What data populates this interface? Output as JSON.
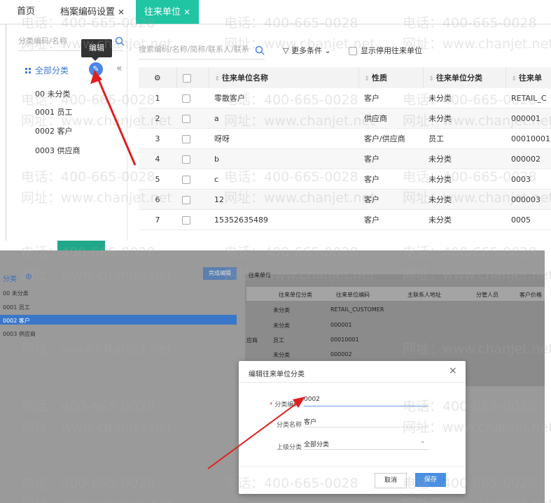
{
  "tabs": [
    {
      "label": "首页",
      "closable": false
    },
    {
      "label": "档案编码设置",
      "closable": true
    },
    {
      "label": "往来单位",
      "closable": true,
      "active": true
    }
  ],
  "close_glyph": "×",
  "left": {
    "search_placeholder": "分类编码/名称",
    "tooltip": "编辑",
    "all_label": "全部分类",
    "tree": [
      "00 未分类",
      "0001 员工",
      "0002 客户",
      "0003 供应商"
    ]
  },
  "toolbar": {
    "search_placeholder": "搜索编码/名称/简称/联系人/联系",
    "more_conditions": "更多条件",
    "show_disabled": "显示停用往来单位"
  },
  "table": {
    "headers": [
      "往来单位名称",
      "性质",
      "往来单位分类",
      "往来单"
    ],
    "rows": [
      {
        "no": "1",
        "name": "零散客户",
        "type": "客户",
        "category": "未分类",
        "code": "RETAIL_C"
      },
      {
        "no": "2",
        "name": "a",
        "type": "供应商",
        "category": "未分类",
        "code": "000001"
      },
      {
        "no": "3",
        "name": "呀呀",
        "type": "客户/供应商",
        "category": "员工",
        "code": "00010001"
      },
      {
        "no": "4",
        "name": "b",
        "type": "客户",
        "category": "未分类",
        "code": "000002"
      },
      {
        "no": "5",
        "name": "c",
        "type": "客户",
        "category": "未分类",
        "code": "0003"
      },
      {
        "no": "6",
        "name": "12",
        "type": "客户",
        "category": "未分类",
        "code": "000003"
      },
      {
        "no": "7",
        "name": "15352635489",
        "type": "客户",
        "category": "未分类",
        "code": "0005"
      }
    ]
  },
  "bottom": {
    "left_tab": "分类",
    "tree": [
      "00 未分类",
      "0001 员工",
      "0002 客户",
      "0003 供应商"
    ],
    "finish_button": "完成编辑",
    "bg_label": "往来单位",
    "bg_headers": [
      "往来单位分类",
      "往来单位编码",
      "主联系人地址",
      "分管人员",
      "客户价格"
    ],
    "bg_rows": [
      {
        "category": "未分类",
        "code": "RETAIL_CUSTOMER"
      },
      {
        "category": "未分类",
        "code": "000001"
      },
      {
        "type": "应商",
        "category": "员工",
        "code": "00010001"
      },
      {
        "category": "未分类",
        "code": "000002"
      }
    ]
  },
  "dialog": {
    "title": "编辑往来单位分类",
    "code_label": "分类编码",
    "code_value": "0002",
    "name_label": "分类名称",
    "name_value": "客户",
    "parent_label": "上级分类",
    "parent_value": "全部分类",
    "cancel": "取消",
    "save": "保存",
    "close_glyph": "×"
  },
  "watermark": {
    "phone": "电话：400-665-0028",
    "url": "网址：www.chanjet.net"
  },
  "colors": {
    "accent": "#20c5a3",
    "primary": "#4a86e8",
    "arrow": "#e02020"
  }
}
